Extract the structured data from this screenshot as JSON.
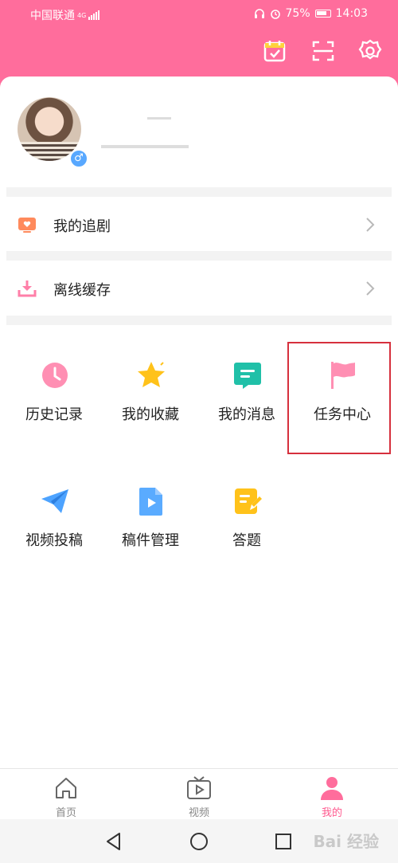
{
  "status_bar": {
    "carrier": "中国联通",
    "network": "4G",
    "battery": "75%",
    "time": "14:03"
  },
  "toolbar": {
    "icons": [
      "calendar-check-icon",
      "scan-icon",
      "settings-icon"
    ]
  },
  "profile": {
    "gender_symbol": "♂"
  },
  "menu": {
    "follow_label": "我的追剧",
    "offline_label": "离线缓存"
  },
  "grid": {
    "items": [
      {
        "label": "历史记录",
        "icon": "clock-icon",
        "color": "#ff7fa8"
      },
      {
        "label": "我的收藏",
        "icon": "star-icon",
        "color": "#ffc21a"
      },
      {
        "label": "我的消息",
        "icon": "message-icon",
        "color": "#20c0a8"
      },
      {
        "label": "任务中心",
        "icon": "flag-icon",
        "color": "#ff7fa8"
      },
      {
        "label": "视频投稿",
        "icon": "paper-plane-icon",
        "color": "#4da3ff"
      },
      {
        "label": "稿件管理",
        "icon": "video-file-icon",
        "color": "#4da3ff"
      },
      {
        "label": "答题",
        "icon": "edit-note-icon",
        "color": "#ffc21a"
      }
    ]
  },
  "tabs": [
    {
      "label": "首页",
      "icon": "home-icon",
      "active": false
    },
    {
      "label": "视频",
      "icon": "tv-icon",
      "active": false
    },
    {
      "label": "我的",
      "icon": "user-icon",
      "active": true
    }
  ],
  "watermark": "Bai 经验",
  "colors": {
    "accent": "#ff6d9c",
    "highlight_border": "#d6303d"
  }
}
